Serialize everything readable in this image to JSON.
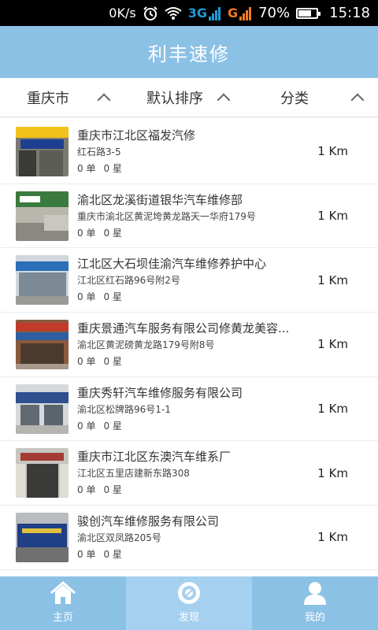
{
  "status_bar": {
    "net_speed": "0K/s",
    "net_3g": "3G",
    "net_g": "G",
    "battery": "70%",
    "time": "15:18"
  },
  "header": {
    "title": "利丰速修"
  },
  "filters": [
    {
      "label": "重庆市"
    },
    {
      "label": "默认排序"
    },
    {
      "label": "分类"
    }
  ],
  "shops": [
    {
      "name": "重庆市江北区福发汽修",
      "address": "红石路3-5",
      "orders": "0 单",
      "stars": "0 星",
      "distance": "1 Km"
    },
    {
      "name": "渝北区龙溪街道银华汽车维修部",
      "address": "重庆市渝北区黄泥垮黄龙路天一华府179号",
      "orders": "0 单",
      "stars": "0 星",
      "distance": "1 Km"
    },
    {
      "name": "江北区大石坝佳渝汽车维修养护中心",
      "address": "江北区红石路96号附2号",
      "orders": "0 单",
      "stars": "0 星",
      "distance": "1 Km"
    },
    {
      "name": "重庆景通汽车服务有限公司修黄龙美容...",
      "address": "渝北区黄泥磅黄龙路179号附8号",
      "orders": "0 单",
      "stars": "0 星",
      "distance": "1 Km"
    },
    {
      "name": "重庆秀轩汽车维修服务有限公司",
      "address": "渝北区松牌路96号1-1",
      "orders": "0 单",
      "stars": "0 星",
      "distance": "1 Km"
    },
    {
      "name": "重庆市江北区东澳汽车维系厂",
      "address": "江北区五里店建新东路308",
      "orders": "0 单",
      "stars": "0 星",
      "distance": "1 Km"
    },
    {
      "name": "骏创汽车维修服务有限公司",
      "address": "渝北区双凤路205号",
      "orders": "0 单",
      "stars": "0 星",
      "distance": "1 Km"
    }
  ],
  "tabs": [
    {
      "label": "主页",
      "icon": "home-icon"
    },
    {
      "label": "发现",
      "icon": "discover-icon"
    },
    {
      "label": "我的",
      "icon": "user-icon"
    }
  ],
  "colors": {
    "header_bg": "#8cc1e6",
    "tab_active_bg": "#a6d0ef"
  }
}
